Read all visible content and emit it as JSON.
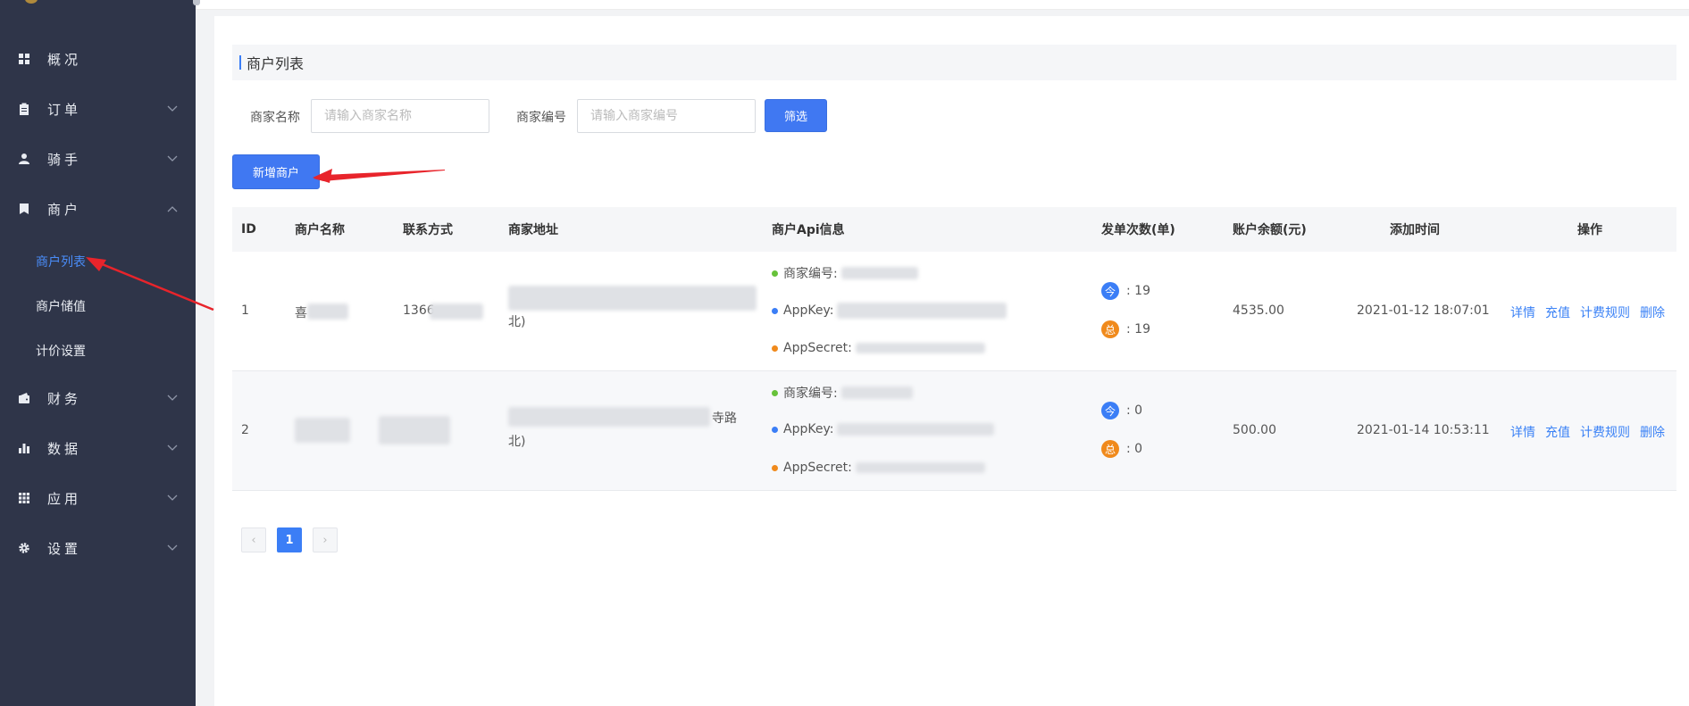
{
  "sidebar": {
    "items": [
      {
        "label": "概况",
        "icon": "dashboard-icon",
        "expandable": false
      },
      {
        "label": "订单",
        "icon": "clipboard-icon",
        "expandable": true
      },
      {
        "label": "骑手",
        "icon": "user-icon",
        "expandable": true
      },
      {
        "label": "商户",
        "icon": "bookmark-icon",
        "expandable": true,
        "expanded": true,
        "children": [
          {
            "label": "商户列表",
            "active": true
          },
          {
            "label": "商户储值"
          },
          {
            "label": "计价设置"
          }
        ]
      },
      {
        "label": "财务",
        "icon": "wallet-icon",
        "expandable": true
      },
      {
        "label": "数据",
        "icon": "bar-chart-icon",
        "expandable": true
      },
      {
        "label": "应用",
        "icon": "grid-icon",
        "expandable": true
      },
      {
        "label": "设置",
        "icon": "gear-icon",
        "expandable": true
      }
    ]
  },
  "main": {
    "title": "商户列表",
    "filters": {
      "name_label": "商家名称",
      "name_placeholder": "请输入商家名称",
      "code_label": "商家编号",
      "code_placeholder": "请输入商家编号",
      "filter_button": "筛选"
    },
    "add_button": "新增商户",
    "table": {
      "headers": [
        "ID",
        "商户名称",
        "联系方式",
        "商家地址",
        "商户Api信息",
        "发单次数(单)",
        "账户余额(元)",
        "添加时间",
        "操作"
      ],
      "api_labels": {
        "code": "商家编号:",
        "appkey": "AppKey:",
        "appsecret": "AppSecret:"
      },
      "count_labels": {
        "today": "今",
        "total": "总"
      },
      "rows": [
        {
          "id": "1",
          "name": "喜",
          "phone": "1366",
          "address_line1": "",
          "address_line2": "北)",
          "today_count": ": 19",
          "total_count": ": 19",
          "balance": "4535.00",
          "time": "2021-01-12 18:07:01"
        },
        {
          "id": "2",
          "name": "",
          "phone": "",
          "address_line1": "寺路",
          "address_line2": "北)",
          "today_count": ": 0",
          "total_count": ": 0",
          "balance": "500.00",
          "time": "2021-01-14 10:53:11"
        }
      ],
      "ops": [
        "详情",
        "充值",
        "计费规则",
        "删除"
      ]
    },
    "pagination": {
      "prev": "‹",
      "current": "1",
      "next": "›"
    }
  },
  "colors": {
    "sidebar_bg": "#2f3549",
    "accent": "#4078f2",
    "link": "#3b82f6",
    "dot_green": "#67c23a",
    "dot_blue": "#3b7ef6",
    "dot_orange": "#f08a1c",
    "annotation_arrow": "#e8242b"
  }
}
